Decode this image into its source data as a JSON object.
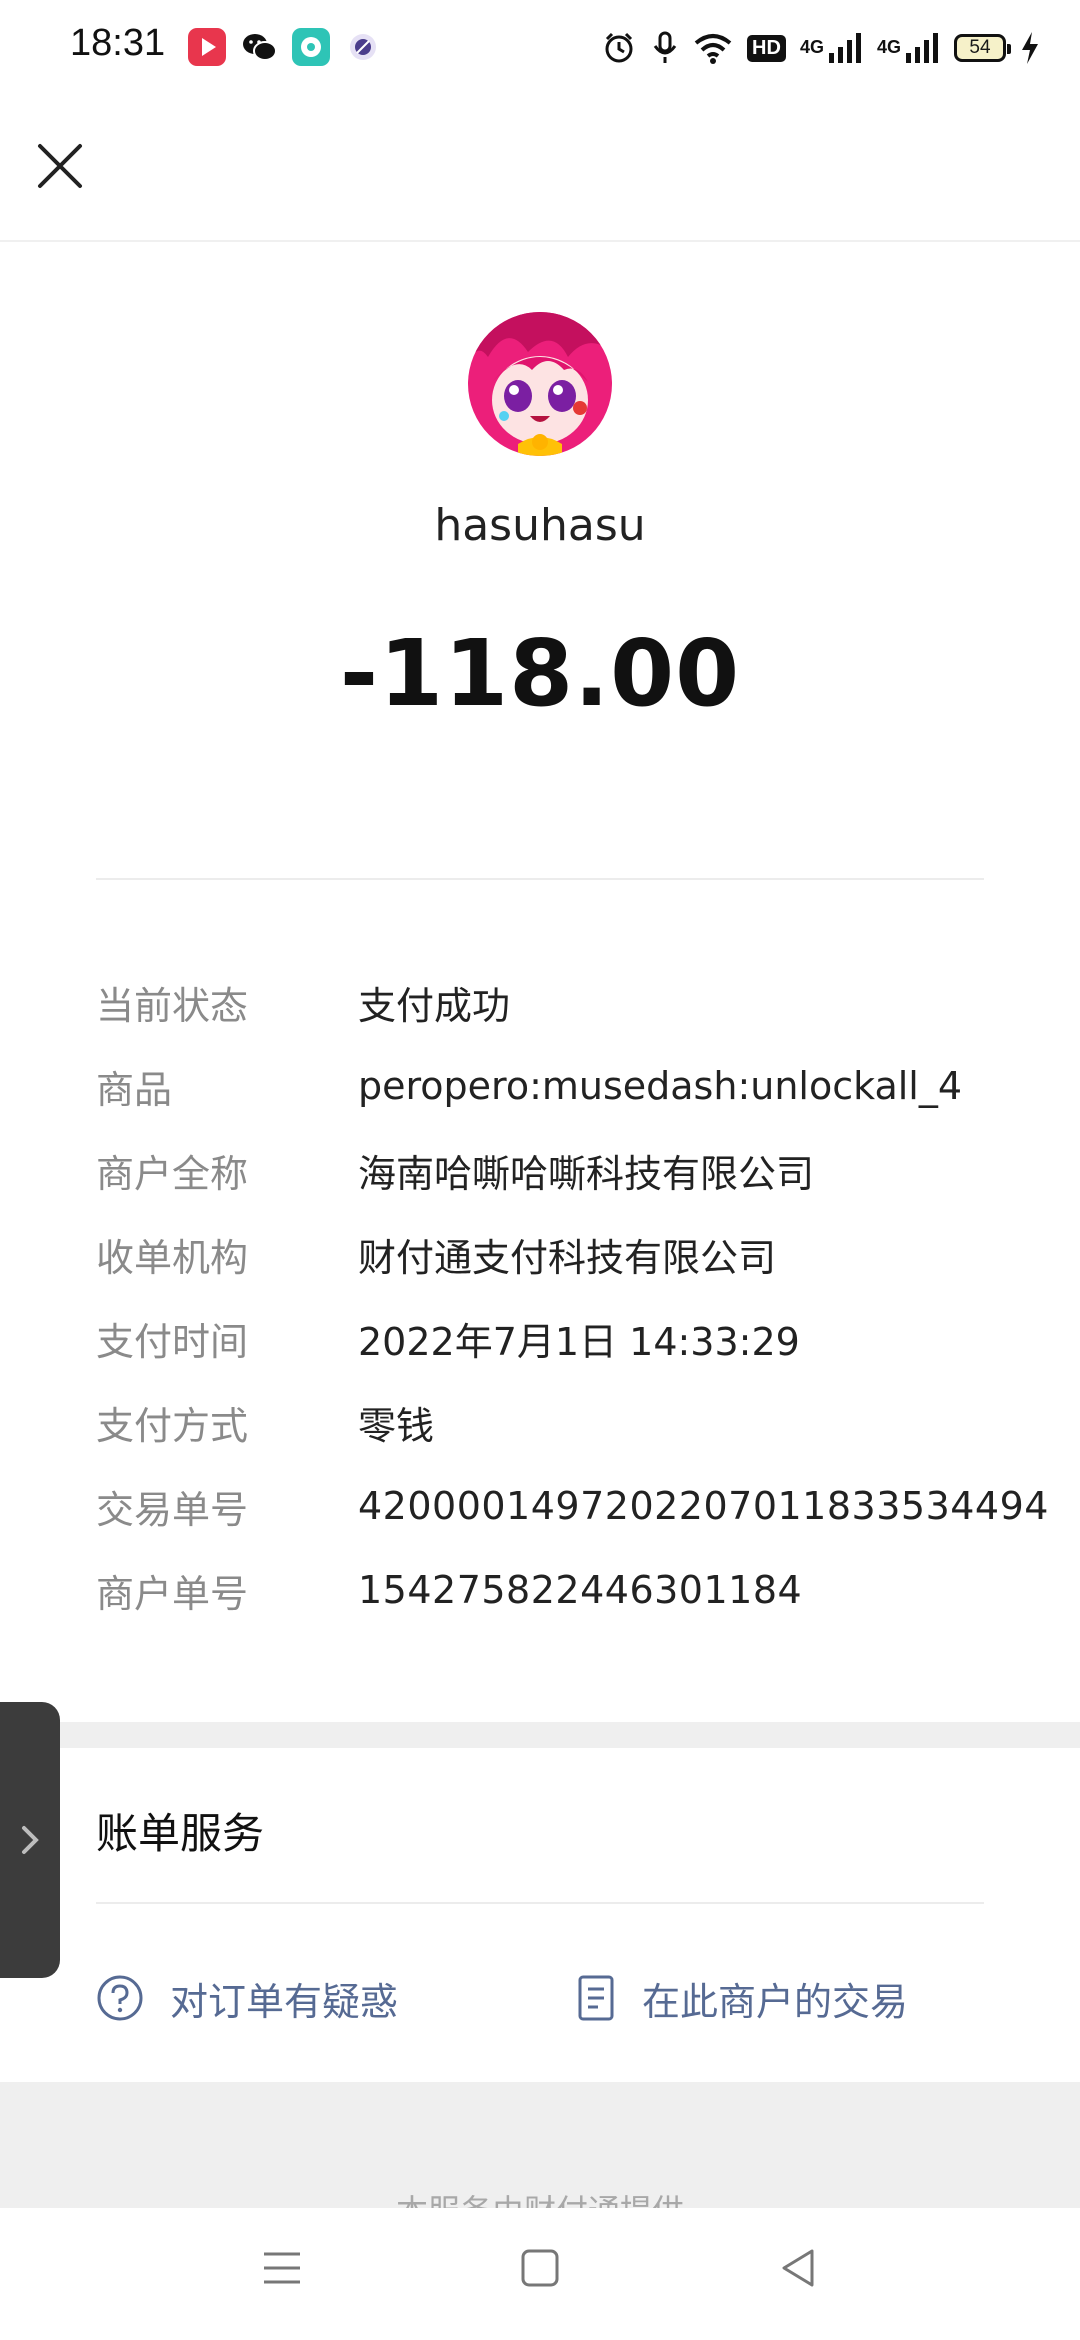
{
  "status_bar": {
    "time": "18:31",
    "hd_label": "HD",
    "net1": "4G",
    "net2": "4G",
    "battery": "54"
  },
  "payee": {
    "name": "hasuhasu",
    "amount": "-118.00"
  },
  "details": [
    {
      "label": "当前状态",
      "value": "支付成功"
    },
    {
      "label": "商品",
      "value": "peropero:musedash:unlockall_4"
    },
    {
      "label": "商户全称",
      "value": "海南哈嘶哈嘶科技有限公司"
    },
    {
      "label": "收单机构",
      "value": "财付通支付科技有限公司"
    },
    {
      "label": "支付时间",
      "value": "2022年7月1日 14:33:29"
    },
    {
      "label": "支付方式",
      "value": "零钱"
    },
    {
      "label": "交易单号",
      "value": "4200001497202207011833534494"
    },
    {
      "label": "商户单号",
      "value": "154275822446301184"
    }
  ],
  "services": {
    "title": "账单服务",
    "question_label": "对订单有疑惑",
    "merchant_tx_label": "在此商户的交易"
  },
  "footer": {
    "text": "本服务由财付通提供"
  },
  "colors": {
    "link": "#566a93",
    "label": "#8a8a8a"
  }
}
